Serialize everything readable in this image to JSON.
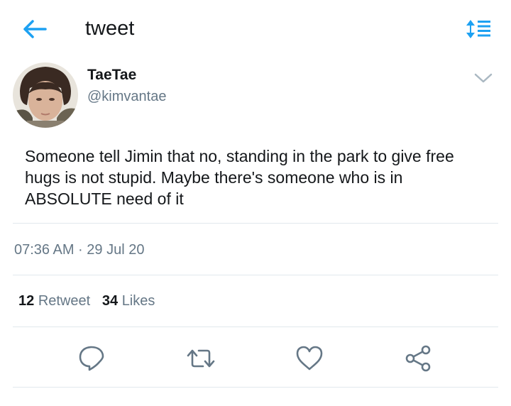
{
  "header": {
    "title": "tweet",
    "back_icon": "arrow-left-icon",
    "sort_icon": "sort-icon"
  },
  "author": {
    "name": "TaeTae",
    "handle": "@kimvantae"
  },
  "tweet": {
    "text": "Someone tell Jimin that no, standing in the park to give free hugs is not stupid. Maybe there's someone who is in ABSOLUTE need of it",
    "timestamp": "07:36 AM · 29 Jul 20"
  },
  "stats": {
    "retweet_count": "12",
    "retweet_label": "Retweet",
    "likes_count": "34",
    "likes_label": "Likes"
  },
  "actions": [
    "reply-icon",
    "retweet-icon",
    "like-icon",
    "share-icon"
  ],
  "colors": {
    "accent": "#1da1f2",
    "text": "#14171a",
    "secondary": "#657786",
    "divider": "#e1e8ed"
  }
}
